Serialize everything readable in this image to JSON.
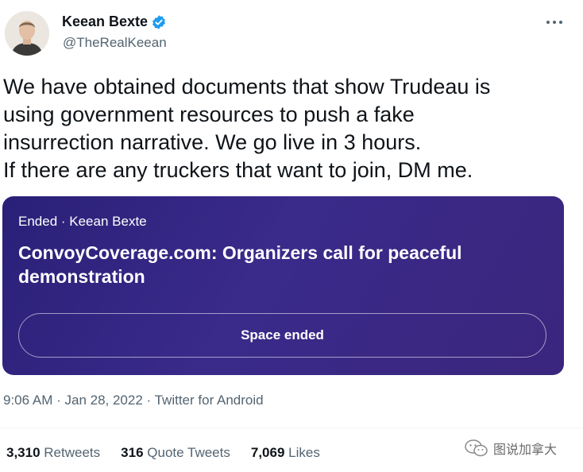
{
  "user": {
    "name": "Keean Bexte",
    "handle": "@TheRealKeean"
  },
  "tweet": {
    "text": "We have obtained documents that show Trudeau is\nusing government resources to push a fake\ninsurrection narrative. We go live in 3 hours.\nIf there are any truckers that want to join, DM me."
  },
  "space": {
    "status": "Ended · Keean Bexte",
    "title": "ConvoyCoverage.com: Organizers call for peaceful demonstration",
    "button_label": "Space ended"
  },
  "meta": {
    "time": "9:06 AM",
    "sep1": " · ",
    "date": "Jan 28, 2022",
    "sep2": " · ",
    "source": "Twitter for Android"
  },
  "stats": [
    {
      "count": "3,310",
      "label": "Retweets"
    },
    {
      "count": "316",
      "label": "Quote Tweets"
    },
    {
      "count": "7,069",
      "label": "Likes"
    }
  ],
  "watermark": {
    "text": "图说加拿大"
  },
  "icons": {
    "verified": "verified-badge-icon",
    "more": "more-options-icon",
    "watermark": "wechat-icon"
  },
  "colors": {
    "verified_blue": "#1d9bf0",
    "secondary_text": "#536471",
    "space_card_bg": "#2f2480"
  }
}
